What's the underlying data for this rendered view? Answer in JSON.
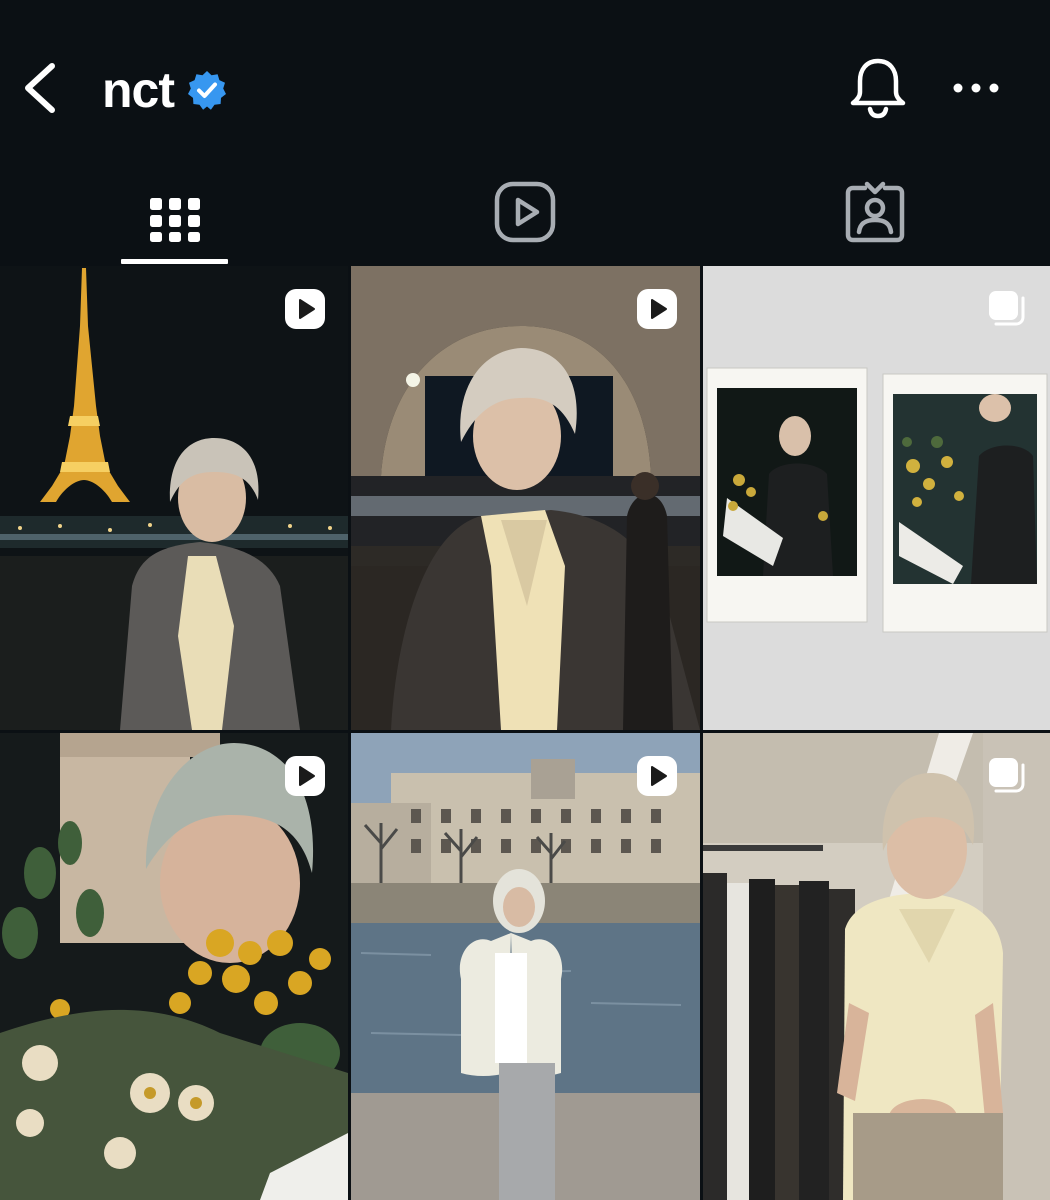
{
  "header": {
    "title": "nct",
    "verified": true,
    "icons": {
      "back": "chevron-left-icon",
      "verified": "verified-badge-icon",
      "notifications": "bell-icon",
      "more": "more-horizontal-icon"
    }
  },
  "tabs": [
    {
      "icon": "grid-icon",
      "active": true
    },
    {
      "icon": "reels-icon",
      "active": false
    },
    {
      "icon": "tagged-icon",
      "active": false
    }
  ],
  "colors": {
    "background": "#0b1014",
    "verified": "#3797f0",
    "foreground": "#ffffff"
  },
  "posts": [
    {
      "type": "reel",
      "badge": "reel-icon",
      "subject": "eiffel-tower-night"
    },
    {
      "type": "reel",
      "badge": "reel-icon",
      "subject": "bridge-arch-night"
    },
    {
      "type": "carousel",
      "badge": "carousel-icon",
      "subject": "polaroids-on-wall"
    },
    {
      "type": "reel",
      "badge": "reel-icon",
      "subject": "flowers-bouquet"
    },
    {
      "type": "reel",
      "badge": "reel-icon",
      "subject": "seine-riverbank"
    },
    {
      "type": "carousel",
      "badge": "carousel-icon",
      "subject": "clothing-store"
    }
  ]
}
